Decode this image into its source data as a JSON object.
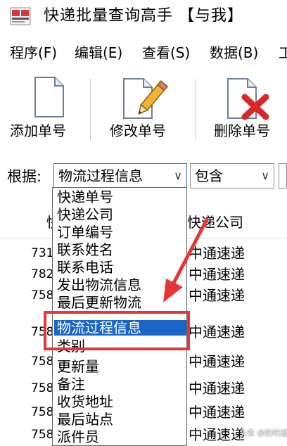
{
  "window": {
    "title": "快递批量查询高手 【与我】",
    "accent_color": "#1a66c8",
    "highlight_color": "#e53535"
  },
  "menu": {
    "items": [
      "程序(F)",
      "编辑(E)",
      "查看(S)",
      "数据(B)",
      "工"
    ]
  },
  "toolbar": {
    "add_label": "添加单号",
    "edit_label": "修改单号",
    "delete_label": "删除单号",
    "add_icon": "document-icon",
    "edit_icon": "document-pencil-icon",
    "delete_icon": "document-delete-icon"
  },
  "filter": {
    "label": "根据:",
    "field_value": "物流过程信息",
    "condition_value": "包含"
  },
  "dropdown": {
    "options": [
      "快递单号",
      "快递公司",
      "订单编号",
      "联系姓名",
      "联系电话",
      "发出物流信息",
      "最后更新物流",
      "物流过程信息",
      "类别",
      "更新量",
      "备注",
      "收货地址",
      "最后站点",
      "派件员"
    ],
    "selected": "物流过程信息"
  },
  "table": {
    "header_company": "快递公司",
    "header_tracking_fragment": "快",
    "rows": [
      {
        "tracking_prefix": "731",
        "company": "中通速递"
      },
      {
        "tracking_prefix": "782",
        "company": "中通速递"
      },
      {
        "tracking_prefix": "758",
        "company": "中通速递"
      },
      {
        "tracking_prefix": "758",
        "company": "中通速递"
      },
      {
        "tracking_prefix": "758",
        "company": "中通速递"
      },
      {
        "tracking_prefix": "758",
        "company": "中通速递"
      },
      {
        "tracking_prefix": "758",
        "company": "中通速递"
      },
      {
        "tracking_prefix": "758",
        "company": "中通速递"
      }
    ]
  },
  "watermark": "头条 @奶味道"
}
